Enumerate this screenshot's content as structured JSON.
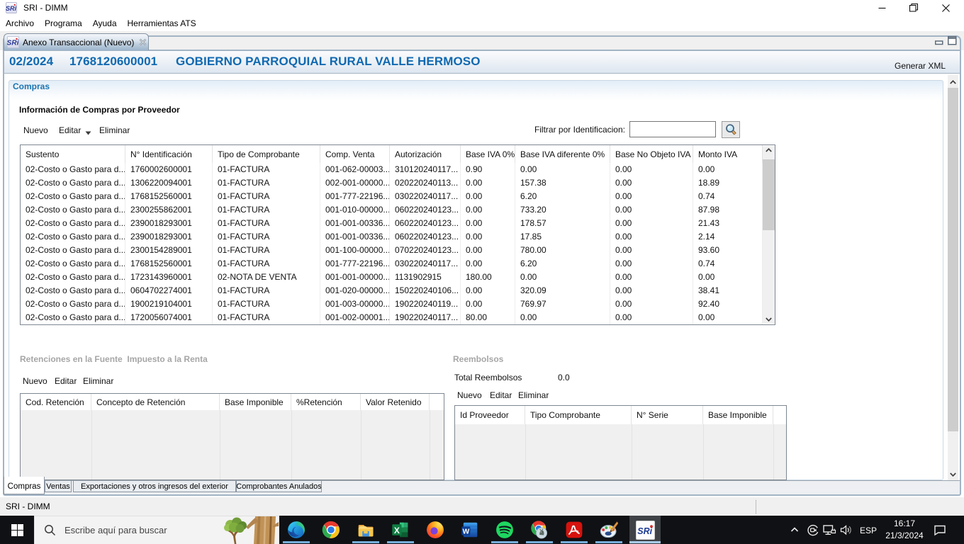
{
  "window": {
    "title": "SRI - DIMM",
    "menu": [
      "Archivo",
      "Programa",
      "Ayuda",
      "Herramientas ATS"
    ]
  },
  "editor_tab": {
    "label": "Anexo Transaccional (Nuevo)"
  },
  "view_header": {
    "period": "02/2024",
    "ruc": "1768120600001",
    "name": "GOBIERNO PARROQUIAL RURAL VALLE HERMOSO",
    "action": "Generar XML"
  },
  "compras": {
    "section_title": "Compras",
    "subtitle": "Información de Compras por Proveedor",
    "toolbar": {
      "nuevo": "Nuevo",
      "editar": "Editar",
      "eliminar": "Eliminar"
    },
    "filter_label": "Filtrar por Identificacion:",
    "filter_value": "",
    "table": {
      "columns": [
        "Sustento",
        "N° Identificación",
        "Tipo de Comprobante",
        "Comp. Venta",
        "Autorización",
        "Base IVA 0%",
        "Base IVA diferente 0%",
        "Base No Objeto IVA",
        "Monto IVA"
      ],
      "rows": [
        [
          "02-Costo o Gasto para d...",
          "1760002600001",
          "01-FACTURA",
          "001-062-00003...",
          "310120240117...",
          "0.90",
          "0.00",
          "0.00",
          "0.00"
        ],
        [
          "02-Costo o Gasto para d...",
          "1306220094001",
          "01-FACTURA",
          "002-001-00000...",
          "020220240113...",
          "0.00",
          "157.38",
          "0.00",
          "18.89"
        ],
        [
          "02-Costo o Gasto para d...",
          "1768152560001",
          "01-FACTURA",
          "001-777-22196...",
          "030220240117...",
          "0.00",
          "6.20",
          "0.00",
          "0.74"
        ],
        [
          "02-Costo o Gasto para d...",
          "2300255862001",
          "01-FACTURA",
          "001-010-00000...",
          "060220240123...",
          "0.00",
          "733.20",
          "0.00",
          "87.98"
        ],
        [
          "02-Costo o Gasto para d...",
          "2390018293001",
          "01-FACTURA",
          "001-001-00336...",
          "060220240123...",
          "0.00",
          "178.57",
          "0.00",
          "21.43"
        ],
        [
          "02-Costo o Gasto para d...",
          "2390018293001",
          "01-FACTURA",
          "001-001-00336...",
          "060220240123...",
          "0.00",
          "17.85",
          "0.00",
          "2.14"
        ],
        [
          "02-Costo o Gasto para d...",
          "2300154289001",
          "01-FACTURA",
          "001-100-00000...",
          "070220240123...",
          "0.00",
          "780.00",
          "0.00",
          "93.60"
        ],
        [
          "02-Costo o Gasto para d...",
          "1768152560001",
          "01-FACTURA",
          "001-777-22196...",
          "030220240117...",
          "0.00",
          "6.20",
          "0.00",
          "0.74"
        ],
        [
          "02-Costo o Gasto para d...",
          "1723143960001",
          "02-NOTA DE VENTA",
          "001-001-00000...",
          "1131902915",
          "180.00",
          "0.00",
          "0.00",
          "0.00"
        ],
        [
          "02-Costo o Gasto para d...",
          "0604702274001",
          "01-FACTURA",
          "001-020-00000...",
          "150220240106...",
          "0.00",
          "320.09",
          "0.00",
          "38.41"
        ],
        [
          "02-Costo o Gasto para d...",
          "1900219104001",
          "01-FACTURA",
          "001-003-00000...",
          "190220240119...",
          "0.00",
          "769.97",
          "0.00",
          "92.40"
        ],
        [
          "02-Costo o Gasto para d...",
          "1720056074001",
          "01-FACTURA",
          "001-002-00001...",
          "190220240117...",
          "80.00",
          "0.00",
          "0.00",
          "0.00"
        ]
      ]
    }
  },
  "retenciones": {
    "title_part1": "Retenciones en la Fuente",
    "title_part2": "Impuesto a la Renta",
    "toolbar": {
      "nuevo": "Nuevo",
      "editar": "Editar",
      "eliminar": "Eliminar"
    },
    "table": {
      "columns": [
        "Cod. Retención",
        "Concepto de Retención",
        "Base Imponible",
        "%Retención",
        "Valor Retenido"
      ],
      "rows": []
    }
  },
  "reembolsos": {
    "title": "Reembolsos",
    "total_label": "Total Reembolsos",
    "total_value": "0.0",
    "toolbar": {
      "nuevo": "Nuevo",
      "editar": "Editar",
      "eliminar": "Eliminar"
    },
    "table": {
      "columns": [
        "Id Proveedor",
        "Tipo Comprobante",
        "N° Serie",
        "Base Imponible"
      ],
      "rows": []
    }
  },
  "bottom_tabs": {
    "tabs": [
      "Compras",
      "Ventas",
      "Exportaciones y otros ingresos del exterior",
      "Comprobantes Anulados"
    ],
    "active_index": 0
  },
  "statusbar": {
    "text": "SRI - DIMM"
  },
  "taskbar": {
    "search_placeholder": "Escribe aquí para buscar",
    "icons": [
      "edge",
      "chrome",
      "file-explorer",
      "excel",
      "firefox",
      "word",
      "spotify",
      "chrome-shortcut",
      "acrobat",
      "paint",
      "sri-dimm"
    ],
    "tray": {
      "language": "ESP",
      "time": "16:17",
      "date": "21/3/2024"
    }
  },
  "colors": {
    "header_blue": "#1069b0",
    "frame_border": "#a2b4c5",
    "taskbar_bg": "#101114",
    "underline_accent": "#76aedb"
  }
}
